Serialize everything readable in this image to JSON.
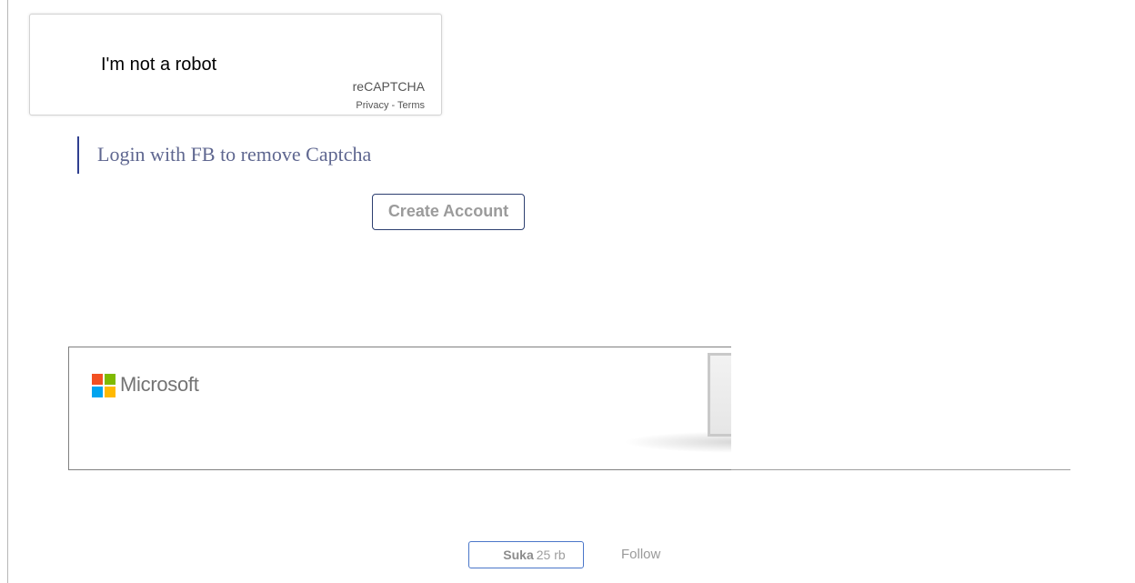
{
  "captcha": {
    "label": "I'm not a robot",
    "brand": "reCAPTCHA",
    "privacy_link": "Privacy",
    "separator": " - ",
    "terms_link": "Terms"
  },
  "fb_login": {
    "text": "Login with FB to remove Captcha"
  },
  "create_account": {
    "label": "Create Account"
  },
  "ad": {
    "brand": "Microsoft",
    "logo_icon": "microsoft-logo-icon",
    "logo_colors": [
      "#f25022",
      "#7fba00",
      "#00a4ef",
      "#ffb900"
    ]
  },
  "social": {
    "like_label": "Suka",
    "like_count": "25 rb",
    "follow_label": "Follow"
  },
  "colors": {
    "accent_border": "#2d3f70",
    "fb_text": "#5f6790",
    "muted_text": "#9b9b9b"
  }
}
